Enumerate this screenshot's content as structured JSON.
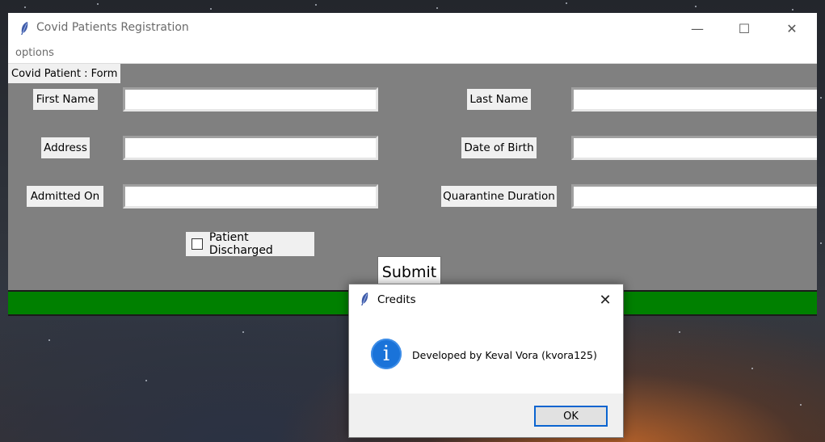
{
  "window": {
    "title": "Covid Patients Registration",
    "minimize_glyph": "—",
    "maximize_glyph": "☐",
    "close_glyph": "✕"
  },
  "menu": {
    "items": [
      "options"
    ]
  },
  "form": {
    "frame_label": "Covid Patient : Form",
    "fields": {
      "first_name": {
        "label": "First Name",
        "value": ""
      },
      "last_name": {
        "label": "Last Name",
        "value": ""
      },
      "address": {
        "label": "Address",
        "value": ""
      },
      "date_of_birth": {
        "label": "Date of Birth",
        "value": ""
      },
      "admitted_on": {
        "label": "Admitted On",
        "value": ""
      },
      "quarantine_duration": {
        "label": "Quarantine Duration",
        "value": ""
      }
    },
    "discharged": {
      "label": "Patient Discharged",
      "checked": false
    },
    "submit_label": "Submit"
  },
  "dialog": {
    "title": "Credits",
    "close_glyph": "✕",
    "icon": "info-icon",
    "icon_glyph": "i",
    "message": "Developed by Keval Vora (kvora125)",
    "ok_label": "OK"
  },
  "colors": {
    "form_bg": "#808080",
    "status_bar": "#008000",
    "info_icon": "#1a73d9",
    "ok_border": "#0a64d0"
  }
}
